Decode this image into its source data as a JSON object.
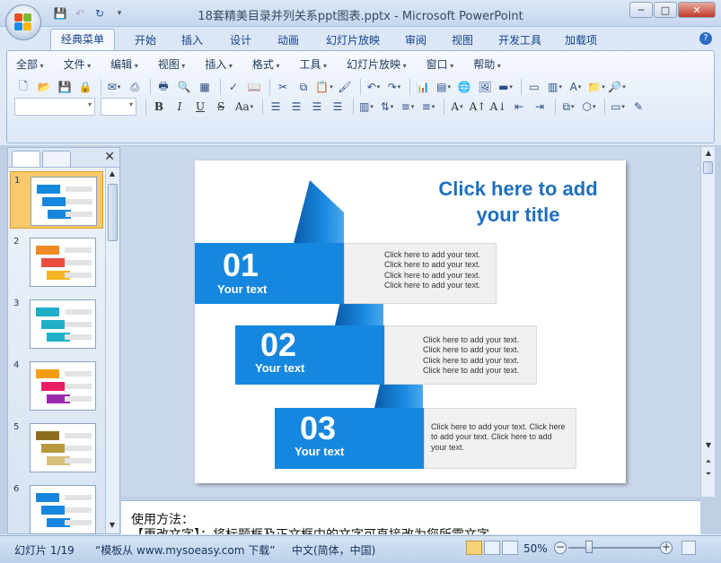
{
  "window": {
    "title": "18套精美目录并列关系ppt图表.pptx - Microsoft PowerPoint",
    "minimize": "─",
    "maximize": "□",
    "close": "✕"
  },
  "ribbon_tabs": [
    "经典菜单",
    "开始",
    "插入",
    "设计",
    "动画",
    "幻灯片放映",
    "审阅",
    "视图",
    "开发工具",
    "加载项"
  ],
  "active_tab": "经典菜单",
  "help_label": "?",
  "menu_items": [
    "全部",
    "文件",
    "编辑",
    "视图",
    "插入",
    "格式",
    "工具",
    "幻灯片放映",
    "窗口",
    "帮助"
  ],
  "format_buttons": {
    "bold": "B",
    "italic": "I",
    "underline": "U",
    "strike": "S",
    "case": "Aa",
    "font_color": "A"
  },
  "slide": {
    "title": "Click here to add your title",
    "items": [
      {
        "number": "01",
        "label": "Your text",
        "text": "Click here to add your text. Click here to add your text. Click here to add your text. Click here to add your text."
      },
      {
        "number": "02",
        "label": "Your text",
        "text": "Click here to add your text. Click here to add your text. Click here to add your text. Click here to add your text."
      },
      {
        "number": "03",
        "label": "Your text",
        "text": "Click here to add your text. Click here to add your text. Click here to add your text."
      }
    ]
  },
  "thumbnails": [
    {
      "num": "1",
      "selected": true
    },
    {
      "num": "2",
      "selected": false
    },
    {
      "num": "3",
      "selected": false
    },
    {
      "num": "4",
      "selected": false
    },
    {
      "num": "5",
      "selected": false
    },
    {
      "num": "6",
      "selected": false
    }
  ],
  "notes": {
    "line1": "使用方法：",
    "line2": "【更改文字】：将标题框及正文框中的文字可直接改为您所需文字。"
  },
  "status": {
    "slide_count": "幻灯片 1/19",
    "template": "“模板从 www.mysoeasy.com 下载”",
    "language": "中文(简体，中国)",
    "zoom": "50%",
    "zoom_level": 0.5
  },
  "colors": {
    "accent_blue": "#1587df",
    "title_blue": "#1f6fbf"
  }
}
